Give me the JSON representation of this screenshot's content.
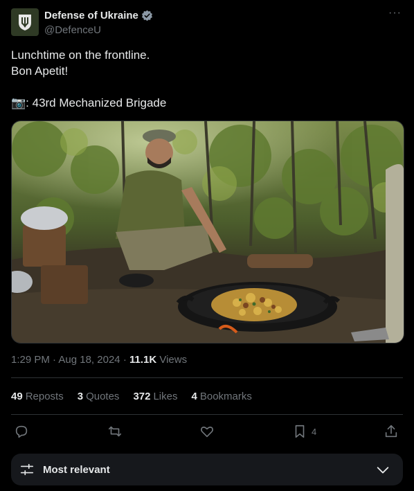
{
  "author": {
    "name": "Defense of Ukraine",
    "handle": "@DefenceU",
    "verified": true,
    "accent": "#1d9bf0"
  },
  "tweet": {
    "lines": [
      "Lunchtime on the frontline.",
      "Bon Apetit!",
      "",
      "📷: 43rd Mechanized Brigade"
    ]
  },
  "meta": {
    "time": "1:29 PM",
    "sep1": "·",
    "date": "Aug 18, 2024",
    "sep2": "·",
    "views_count": "11.1K",
    "views_label": "Views"
  },
  "stats": {
    "reposts": {
      "count": "49",
      "label": "Reposts"
    },
    "quotes": {
      "count": "3",
      "label": "Quotes"
    },
    "likes": {
      "count": "372",
      "label": "Likes"
    },
    "bookmarks": {
      "count": "4",
      "label": "Bookmarks"
    }
  },
  "actions": {
    "bookmark_count": "4"
  },
  "sort": {
    "label": "Most relevant"
  },
  "icons": [
    "emblem-icon",
    "verified-icon",
    "more-icon",
    "reply-icon",
    "repost-icon",
    "like-icon",
    "bookmark-icon",
    "share-icon",
    "filter-icon",
    "chevron-down-icon"
  ]
}
